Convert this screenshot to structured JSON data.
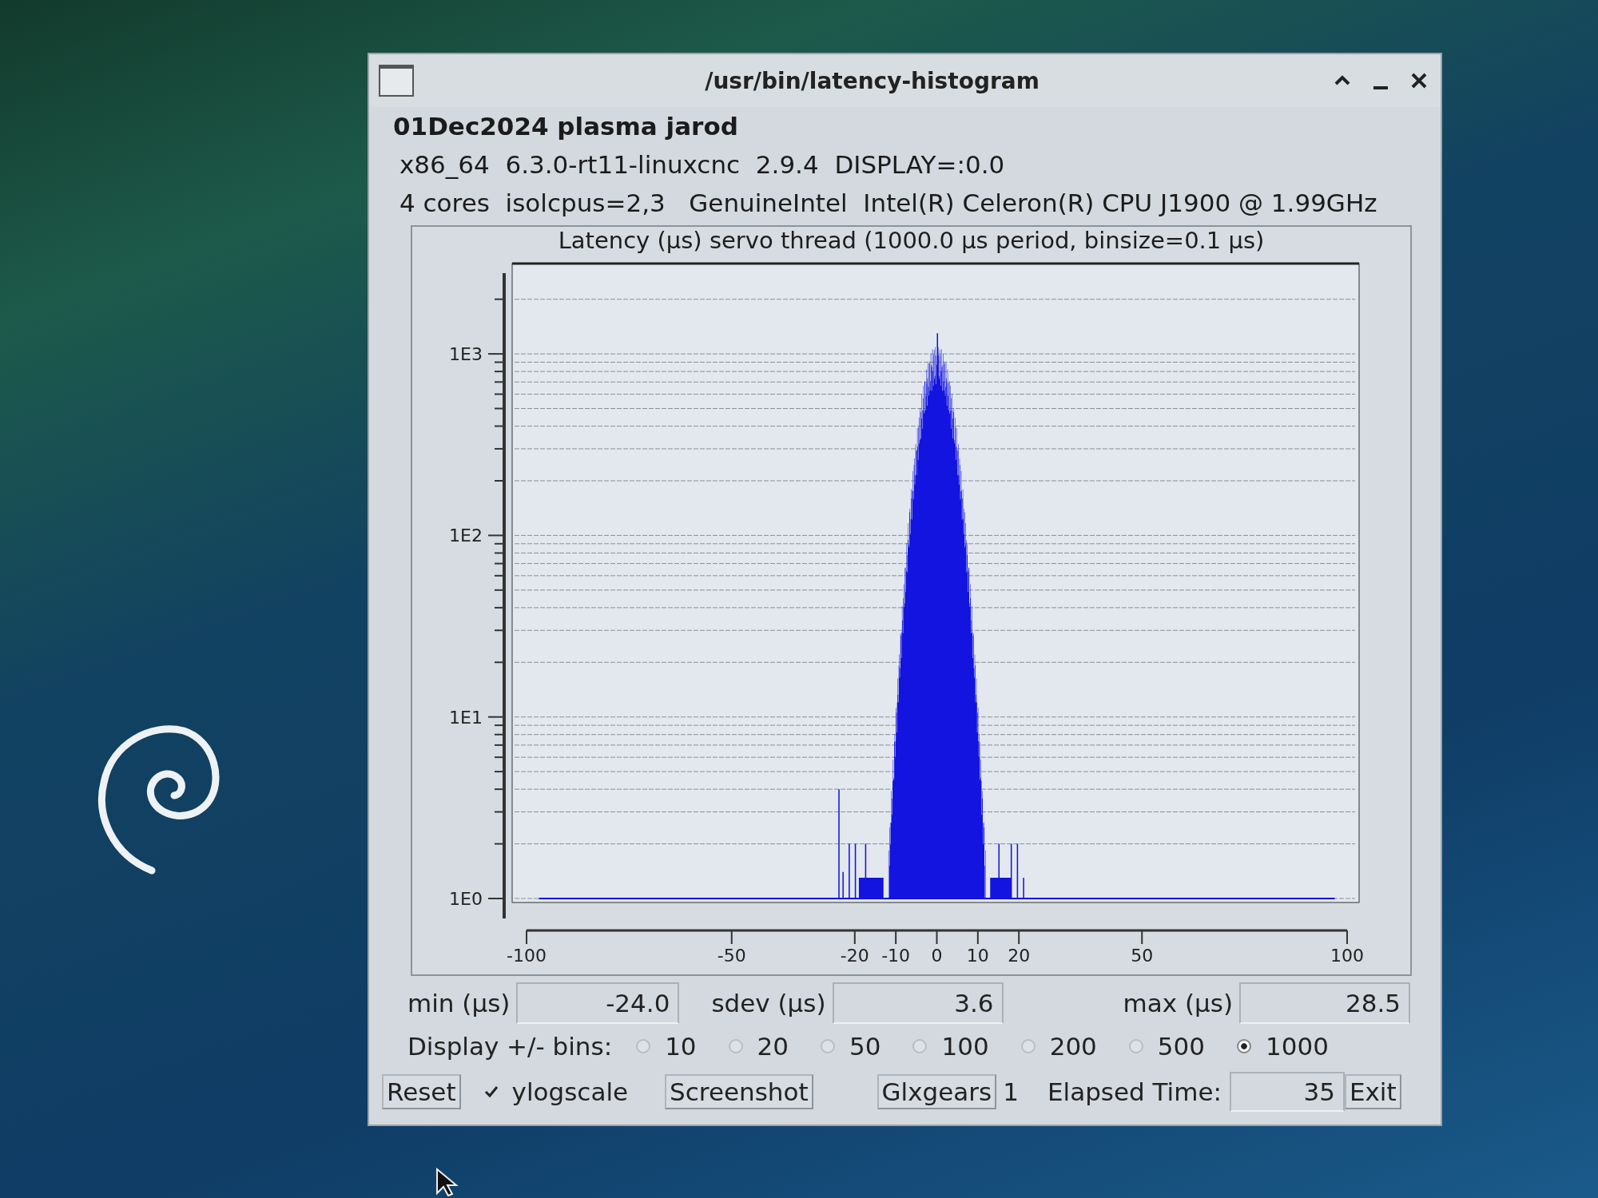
{
  "window": {
    "title": "/usr/bin/latency-histogram"
  },
  "info_lines": [
    "01Dec2024 plasma jarod",
    "x86_64  6.3.0-rt11-linuxcnc  2.9.4  DISPLAY=:0.0",
    "4 cores  isolcpus=2,3   GenuineIntel  Intel(R) Celeron(R) CPU J1900 @ 1.99GHz"
  ],
  "chart": {
    "title": "Latency (µs) servo thread (1000.0 µs period, binsize=0.1 µs)",
    "y_tick_labels": [
      "1E3",
      "1E2",
      "1E1",
      "1E0"
    ],
    "x_tick_labels": [
      "-100",
      "-50",
      "-20",
      "-10",
      "0",
      "10",
      "20",
      "50",
      "100"
    ]
  },
  "stats": [
    {
      "label": "min (µs)",
      "value": "-24.0"
    },
    {
      "label": "sdev (µs)",
      "value": "3.6"
    },
    {
      "label": "max (µs)",
      "value": "28.5"
    }
  ],
  "bins": {
    "label": "Display +/- bins:",
    "options": [
      {
        "label": "10",
        "selected": false
      },
      {
        "label": "20",
        "selected": false
      },
      {
        "label": "50",
        "selected": false
      },
      {
        "label": "100",
        "selected": false
      },
      {
        "label": "200",
        "selected": false
      },
      {
        "label": "500",
        "selected": false
      },
      {
        "label": "1000",
        "selected": true
      }
    ]
  },
  "footer": {
    "reset": "Reset",
    "ylogscale": {
      "label": "ylogscale",
      "checked": true
    },
    "screenshot": "Screenshot",
    "glxgears": {
      "label": "Glxgears",
      "count": "1"
    },
    "elapsed": {
      "label": "Elapsed Time:",
      "value": "35"
    },
    "exit": "Exit"
  }
}
